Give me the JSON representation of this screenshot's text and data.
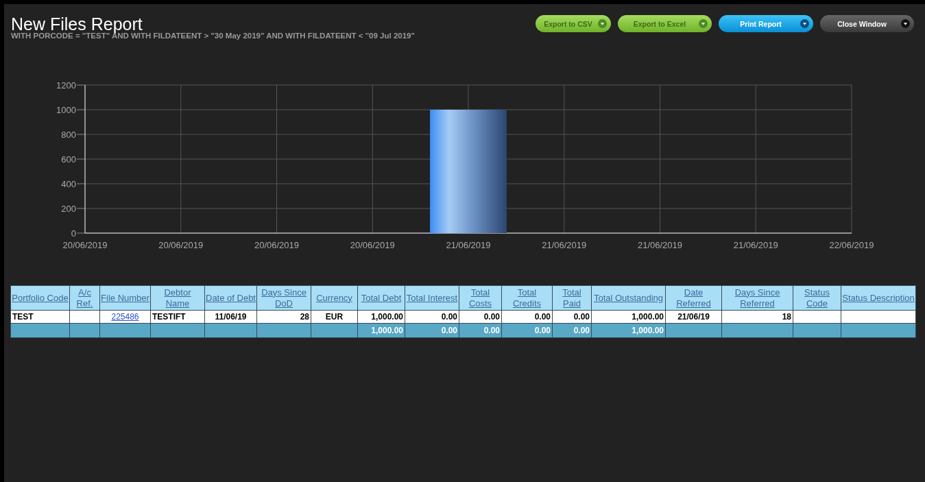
{
  "title": "New Files Report",
  "filter": "WITH PORCODE = \"TEST\" AND WITH FILDATEENT > \"30 May 2019\" AND WITH FILDATEENT < \"09 Jul 2019\"",
  "buttons": [
    {
      "label": "Export to CSV",
      "kind": "green"
    },
    {
      "label": "Export to Excel",
      "kind": "green"
    },
    {
      "label": "Print Report",
      "kind": "blue"
    },
    {
      "label": "Close Window",
      "kind": "dark"
    }
  ],
  "chart_data": {
    "type": "bar",
    "grid": true,
    "categories": [
      "20/06/2019",
      "20/06/2019",
      "20/06/2019",
      "20/06/2019",
      "21/06/2019",
      "21/06/2019",
      "21/06/2019",
      "21/06/2019",
      "22/06/2019"
    ],
    "values": [
      null,
      null,
      null,
      null,
      1000,
      null,
      null,
      null,
      null
    ],
    "ylim": [
      0,
      1200
    ],
    "yticks": [
      0,
      200,
      400,
      600,
      800,
      1000,
      1200
    ]
  },
  "table": {
    "columns": [
      "Portfolio Code",
      "A/c Ref.",
      "File Number",
      "Debtor Name",
      "Date of Debt",
      "Days Since DoD",
      "Currency",
      "Total Debt",
      "Total Interest",
      "Total Costs",
      "Total Credits",
      "Total Paid",
      "Total Outstanding",
      "Date Referred",
      "Days Since Referred",
      "Status Code",
      "Status Description"
    ],
    "rows": [
      {
        "cells": [
          {
            "text": "TEST",
            "kind": "text"
          },
          {
            "kind": "blank"
          },
          {
            "text": "225486",
            "kind": "link"
          },
          {
            "text": "TESTIFT",
            "kind": "text"
          },
          {
            "text": "11/06/19",
            "kind": "text"
          },
          {
            "text": "28",
            "kind": "text"
          },
          {
            "text": "EUR",
            "kind": "text"
          },
          {
            "text": "1,000.00",
            "kind": "text"
          },
          {
            "text": "0.00",
            "kind": "text"
          },
          {
            "text": "0.00",
            "kind": "text"
          },
          {
            "text": "0.00",
            "kind": "text"
          },
          {
            "text": "0.00",
            "kind": "text"
          },
          {
            "text": "1,000.00",
            "kind": "text"
          },
          {
            "text": "21/06/19",
            "kind": "text"
          },
          {
            "text": "18",
            "kind": "text"
          },
          {
            "kind": "blank"
          },
          {
            "kind": "blank"
          }
        ]
      }
    ],
    "totals": [
      {
        "kind": "blank"
      },
      {
        "kind": "blank"
      },
      {
        "kind": "blank"
      },
      {
        "kind": "blank"
      },
      {
        "kind": "blank"
      },
      {
        "kind": "blank"
      },
      {
        "kind": "blank"
      },
      {
        "kind": "total",
        "text": "1,000.00"
      },
      {
        "kind": "total",
        "text": "0.00"
      },
      {
        "kind": "total",
        "text": "0.00"
      },
      {
        "kind": "total",
        "text": "0.00"
      },
      {
        "kind": "total",
        "text": "0.00"
      },
      {
        "kind": "total",
        "text": "1,000.00"
      },
      {
        "kind": "blank"
      },
      {
        "kind": "blank"
      },
      {
        "kind": "blank"
      },
      {
        "kind": "blank"
      }
    ]
  }
}
